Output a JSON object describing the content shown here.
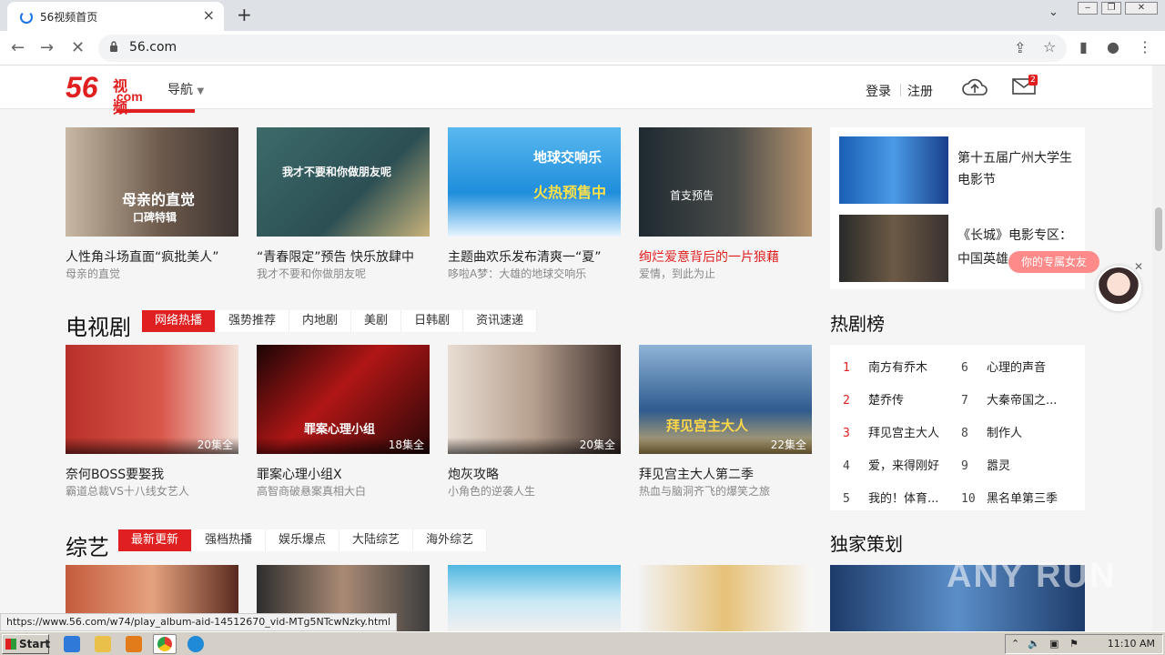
{
  "browser": {
    "tab_title": "56视频首页",
    "url": "56.com",
    "status_url": "https://www.56.com/w74/play_album-aid-14512670_vid-MTg5NTcwNzky.html"
  },
  "header": {
    "logo_num": "56",
    "logo_cn": "视频",
    "logo_dom": ".com",
    "nav_label": "导航",
    "login": "登录",
    "register": "注册",
    "mail_badge": "2"
  },
  "movie": {
    "items": [
      {
        "title": "人性角斗场直面“疯批美人”",
        "sub": "母亲的直觉",
        "thumb_text": "母亲的直觉",
        "thumb_text2": "口碑特辑"
      },
      {
        "title": "“青春限定”预告 快乐放肆中",
        "sub": "我才不要和你做朋友呢",
        "thumb_text": "我才不要和你做朋友呢"
      },
      {
        "title": "主题曲欢乐发布清爽一“夏”",
        "sub": "哆啦A梦：大雄的地球交响乐",
        "thumb_text": "地球交响乐",
        "thumb_text2": "火热预售中"
      },
      {
        "title": "绚烂爱意背后的一片狼藉",
        "sub": "爱情，到此为止",
        "thumb_text": "首支预告"
      }
    ]
  },
  "right_top": {
    "items": [
      {
        "title_line1": "第十五届广州大学生",
        "title_line2": "电影节"
      },
      {
        "title_line1": "《长城》电影专区：",
        "title_line2": "中国英雄"
      }
    ]
  },
  "tv": {
    "heading": "电视剧",
    "tabs": [
      "网络热播",
      "强势推荐",
      "内地剧",
      "美剧",
      "日韩剧",
      "资讯速递"
    ],
    "items": [
      {
        "title": "奈何BOSS要娶我",
        "sub": "霸道总裁VS十八线女艺人",
        "ep": "20集全"
      },
      {
        "title": "罪案心理小组X",
        "sub": "高智商破悬案真相大白",
        "ep": "18集全",
        "thumb_text": "罪案心理小组"
      },
      {
        "title": "炮灰攻略",
        "sub": "小角色的逆袭人生",
        "ep": "20集全"
      },
      {
        "title": "拜见宫主大人第二季",
        "sub": "热血与脑洞齐飞的爆笑之旅",
        "ep": "22集全",
        "thumb_text": "拜见宫主大人"
      }
    ]
  },
  "hot": {
    "heading": "热剧榜",
    "left": [
      {
        "n": "1",
        "t": "南方有乔木"
      },
      {
        "n": "2",
        "t": "楚乔传"
      },
      {
        "n": "3",
        "t": "拜见宫主大人"
      },
      {
        "n": "4",
        "t": "爱，来得刚好"
      },
      {
        "n": "5",
        "t": "我的！体育..."
      }
    ],
    "right": [
      {
        "n": "6",
        "t": "心理的声音"
      },
      {
        "n": "7",
        "t": "大秦帝国之..."
      },
      {
        "n": "8",
        "t": "制作人"
      },
      {
        "n": "9",
        "t": "嚣灵"
      },
      {
        "n": "10",
        "t": "黑名单第三季"
      }
    ]
  },
  "variety": {
    "heading": "综艺",
    "tabs": [
      "最新更新",
      "强档热播",
      "娱乐爆点",
      "大陆综艺",
      "海外综艺"
    ]
  },
  "exclusive": {
    "heading": "独家策划"
  },
  "popup": {
    "label": "你的专属女友",
    "close": "✕"
  },
  "watermark": "ANY RUN",
  "taskbar": {
    "start": "Start",
    "time": "11:10 AM"
  }
}
